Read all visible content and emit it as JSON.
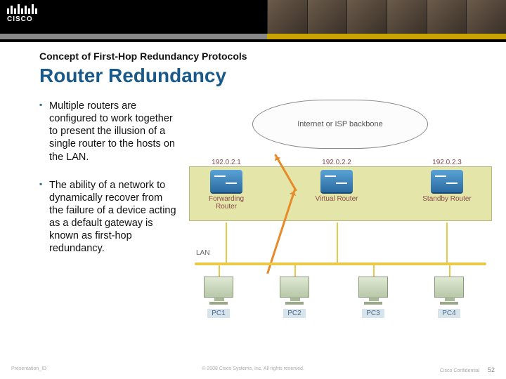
{
  "header": {
    "logo_text": "CISCO"
  },
  "slide": {
    "subtitle": "Concept of First-Hop Redundancy Protocols",
    "title": "Router Redundancy",
    "bullets": [
      "Multiple routers are configured to work together to present the illusion of a single router to the hosts on the LAN.",
      "The ability of a network to dynamically recover from the failure of a device acting as a default gateway is known as first-hop redundancy."
    ]
  },
  "diagram": {
    "cloud_label": "Internet or ISP backbone",
    "routers": [
      {
        "ip": "192.0.2.1",
        "label": "Forwarding Router"
      },
      {
        "ip": "192.0.2.2",
        "label": "Virtual Router"
      },
      {
        "ip": "192.0.2.3",
        "label": "Standby Router"
      }
    ],
    "lan_label": "LAN",
    "pcs": [
      "PC1",
      "PC2",
      "PC3",
      "PC4"
    ]
  },
  "footer": {
    "left": "Presentation_ID",
    "center": "© 2008 Cisco Systems, Inc. All rights reserved.",
    "right": "Cisco Confidential",
    "page": "52"
  }
}
